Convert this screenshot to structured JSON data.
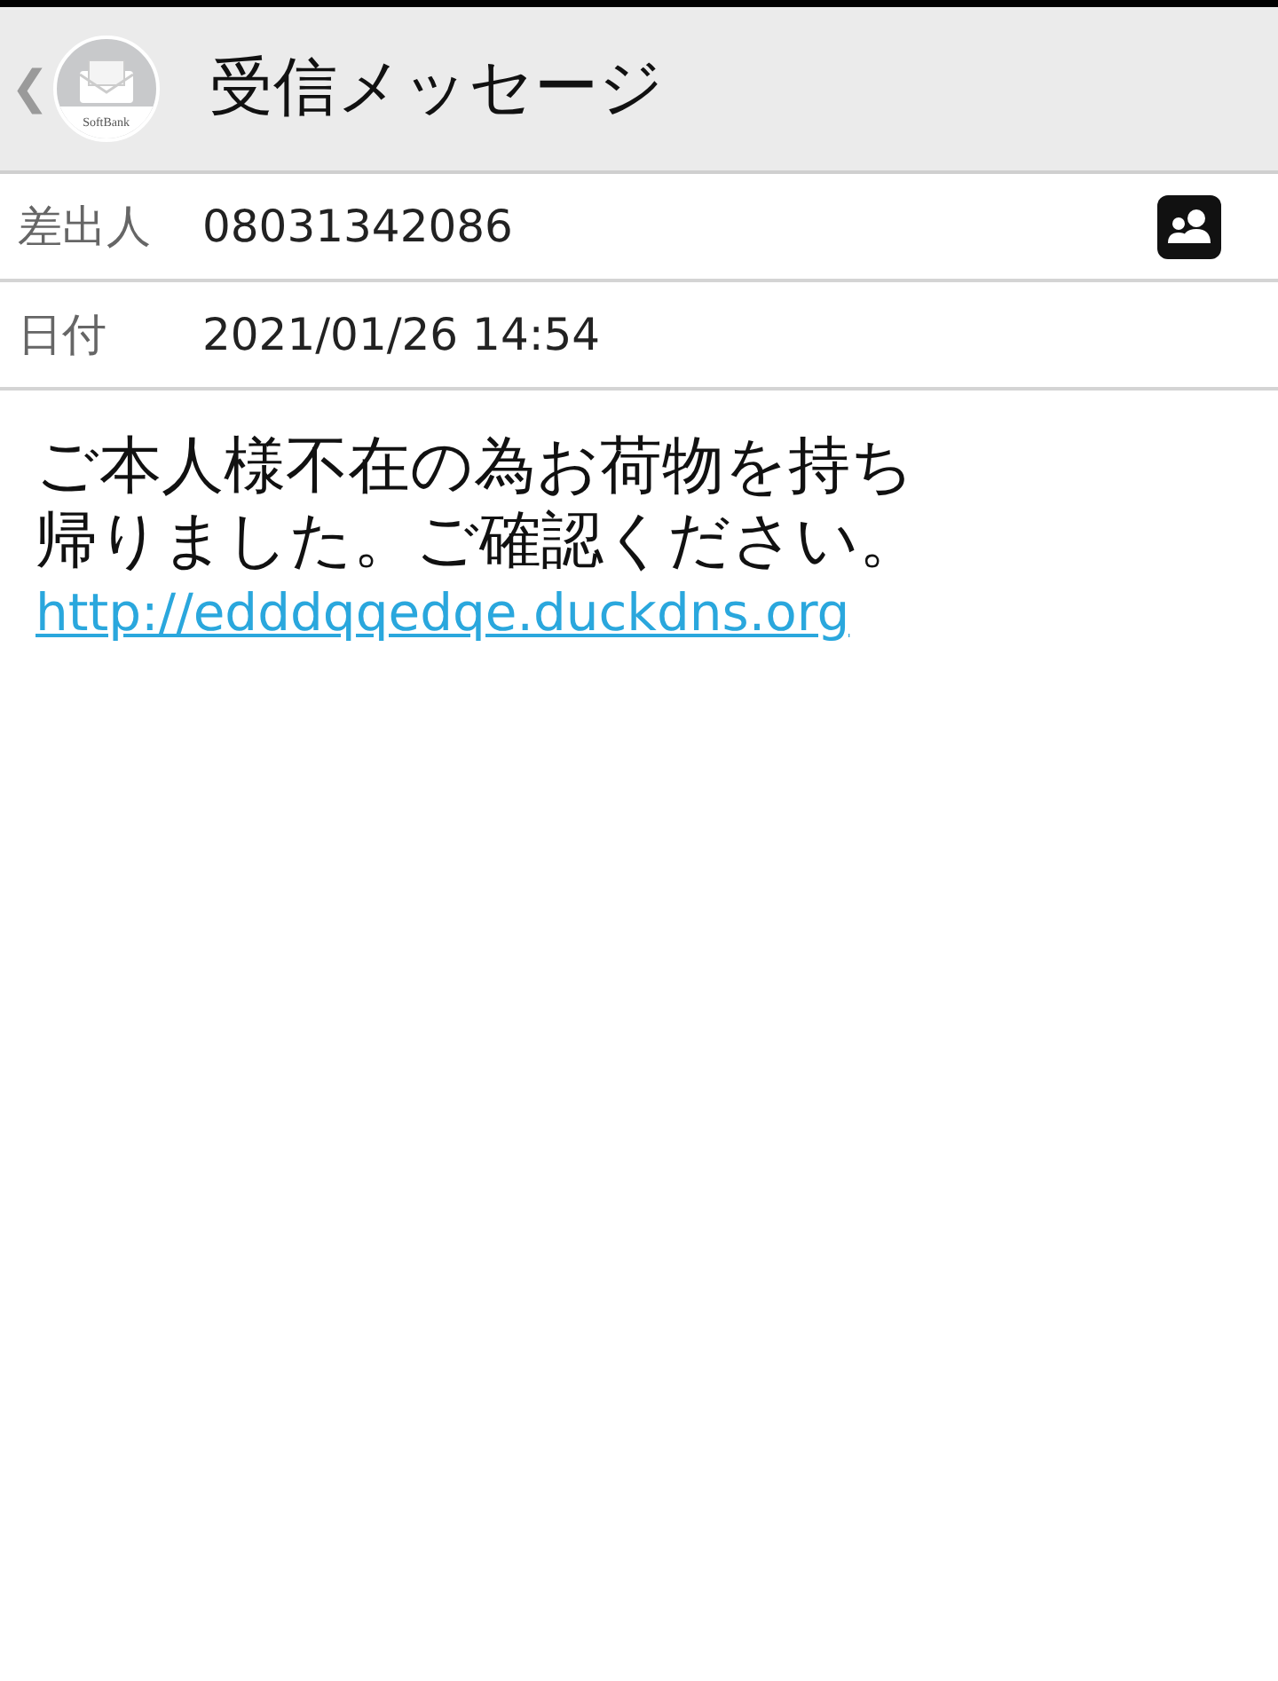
{
  "header": {
    "back": "❮",
    "logo_text": "SoftBank",
    "title": "受信メッセージ"
  },
  "fields": [
    {
      "label": "差出人",
      "value": "08031342086",
      "kind": "contact"
    },
    {
      "label": "日付",
      "value": "2021/01/26 14:54",
      "kind": "plain"
    }
  ],
  "message": {
    "text": "ご本人様不在の為お荷物を持ち帰りました。ご確認ください。",
    "link": "http://edddqqedqe.duckdns.org"
  }
}
